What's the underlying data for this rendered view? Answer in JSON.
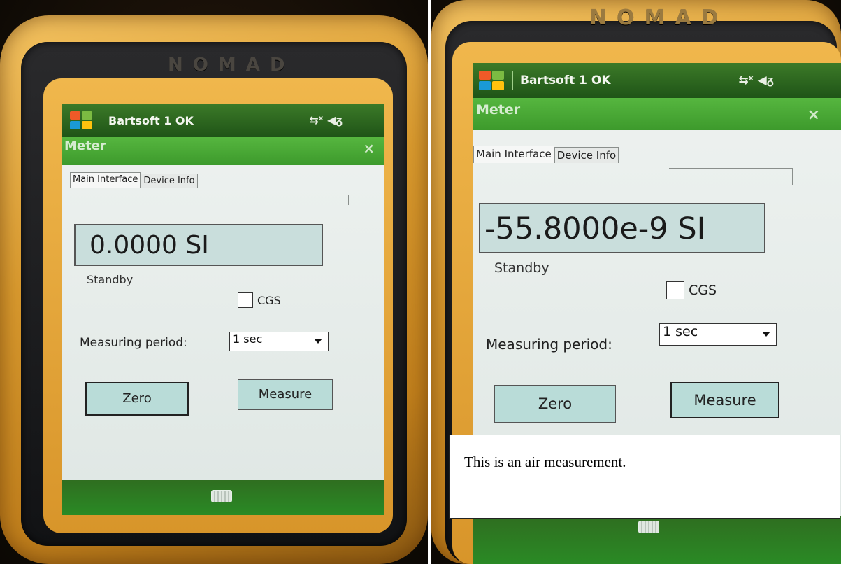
{
  "left_screen": {
    "device_brand": "NOMAD",
    "taskbar": {
      "title": "Bartsoft 1 OK",
      "status_icons": "connectivity-icon volume-icon"
    },
    "window": {
      "title": "Meter",
      "close": "×"
    },
    "tabs": [
      {
        "label": "Main Interface"
      },
      {
        "label": "Device Info"
      }
    ],
    "reading": "0.0000 SI",
    "status": "Standby",
    "cgs": {
      "label": "CGS",
      "checked": false
    },
    "measuring_period": {
      "label": "Measuring period:",
      "value": "1 sec"
    },
    "buttons": {
      "zero": "Zero",
      "measure": "Measure"
    }
  },
  "right_screen": {
    "device_brand": "NOMAD",
    "taskbar": {
      "title": "Bartsoft 1 OK",
      "status_icons": "connectivity-icon volume-icon"
    },
    "window": {
      "title": "Meter",
      "close": "×"
    },
    "tabs": [
      {
        "label": "Main Interface"
      },
      {
        "label": "Device Info"
      }
    ],
    "reading": "-55.8000e-9 SI",
    "status": "Standby",
    "cgs": {
      "label": "CGS",
      "checked": false
    },
    "measuring_period": {
      "label": "Measuring period:",
      "value": "1 sec"
    },
    "buttons": {
      "zero": "Zero",
      "measure": "Measure"
    }
  },
  "caption": "This is an air measurement.",
  "colors": {
    "bumper": "#d99a2e",
    "taskbar_green": "#2f6a20",
    "titlebar_green": "#4aa835",
    "reading_bg": "#c9dedc",
    "button_bg": "#b9dcd8"
  }
}
